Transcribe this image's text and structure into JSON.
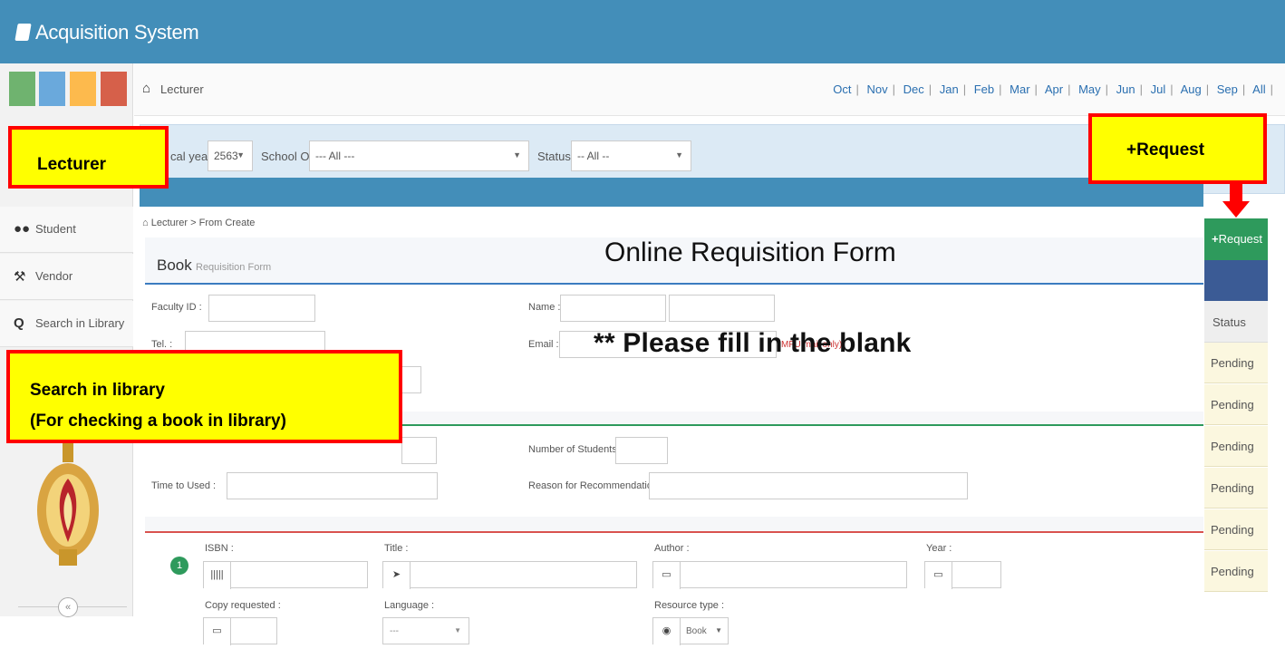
{
  "app": {
    "title": "Acquisition System"
  },
  "header": {
    "breadcrumb": "Lecturer",
    "months": [
      "Oct",
      "Nov",
      "Dec",
      "Jan",
      "Feb",
      "Mar",
      "Apr",
      "May",
      "Jun",
      "Jul",
      "Aug",
      "Sep",
      "All"
    ]
  },
  "sidebar": {
    "shortcut_colors": [
      "#6fb36f",
      "#6aa9dc",
      "#fdba4d",
      "#d6604a"
    ],
    "items": [
      {
        "label": "Student",
        "icon": "users-icon"
      },
      {
        "label": "Vendor",
        "icon": "gavel-icon"
      },
      {
        "label": "Search in Library",
        "icon": "search-icon"
      }
    ]
  },
  "filters": {
    "fiscal_label": "cal year :",
    "fiscal_value": "2563",
    "school_label": "School OF :",
    "school_value": "--- All ---",
    "status_label": "Status :",
    "status_value": "-- All --"
  },
  "form": {
    "breadcrumb_root": "Lecturer",
    "breadcrumb_sep": ">",
    "breadcrumb_current": "From Create",
    "title": "Book",
    "subtitle": "Requisition Form",
    "faculty_id_label": "Faculty ID :",
    "name_label": "Name :",
    "tel_label": "Tel. :",
    "email_label": "Email :",
    "email_hint": "MFU mail only)",
    "students_label": "Number of Students :",
    "time_label": "Time to Used :",
    "reason_label": "Reason for Recommendation :",
    "item_number": "1",
    "isbn_label": "ISBN :",
    "title_label": "Title :",
    "author_label": "Author :",
    "year_label": "Year :",
    "copy_label": "Copy requested :",
    "language_label": "Language :",
    "language_value": "---",
    "resource_label": "Resource type :",
    "resource_value": "Book"
  },
  "right_panel": {
    "request_button": "Request",
    "status_header": "Status",
    "statuses": [
      "Pending",
      "Pending",
      "Pending",
      "Pending",
      "Pending",
      "Pending"
    ]
  },
  "annotations": {
    "lecturer": "Lecturer",
    "request": "+Request",
    "search_line1": "Search in library",
    "search_line2": "(For checking a book in library)",
    "form_title": "Online Requisition Form",
    "fill_note": "** Please fill in the blank"
  },
  "colors": {
    "topbar": "#438eb9",
    "request_green": "#2e9a5c",
    "callout_fill": "#ffff00",
    "callout_border": "#ff0000"
  }
}
